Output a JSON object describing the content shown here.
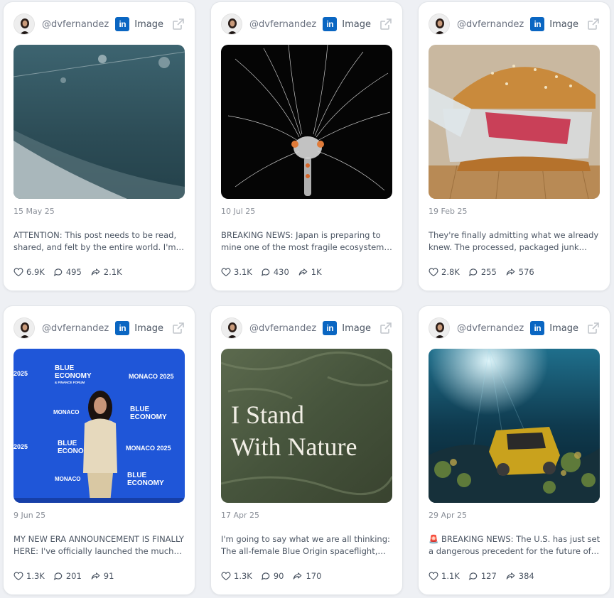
{
  "posts": [
    {
      "handle": "@dvfernandez",
      "network_icon": "linkedin-icon",
      "type_label": "Image",
      "date": "15 May 25",
      "caption": "ATTENTION: This post needs to be read, shared, and felt by the entire world. I'm…",
      "likes": "6.9K",
      "comments": "495",
      "shares": "2.1K",
      "image_subject": "misty underwater seafloor with buoy line"
    },
    {
      "handle": "@dvfernandez",
      "network_icon": "linkedin-icon",
      "type_label": "Image",
      "date": "10 Jul 25",
      "caption": "BREAKING NEWS: Japan is preparing to mine one of the most fragile ecosystem…",
      "likes": "3.1K",
      "comments": "430",
      "shares": "1K",
      "image_subject": "translucent deep-sea shrimp on black"
    },
    {
      "handle": "@dvfernandez",
      "network_icon": "linkedin-icon",
      "type_label": "Image",
      "date": "19 Feb 25",
      "caption": "They're finally admitting what we already knew. The processed, packaged junk…",
      "likes": "2.8K",
      "comments": "255",
      "shares": "576",
      "image_subject": "burger filled with plastic waste"
    },
    {
      "handle": "@dvfernandez",
      "network_icon": "linkedin-icon",
      "type_label": "Image",
      "date": "9 Jun 25",
      "caption": "MY NEW ERA ANNOUNCEMENT IS FINALLY HERE: I've officially launched the much…",
      "likes": "1.3K",
      "comments": "201",
      "shares": "91",
      "image_subject": "woman at event backdrop",
      "backdrop_texts": [
        "BLUE",
        "ECONOMY",
        "& FINANCE FORUM",
        "MONACO 2025",
        "MONACO",
        "2025"
      ]
    },
    {
      "handle": "@dvfernandez",
      "network_icon": "linkedin-icon",
      "type_label": "Image",
      "date": "17 Apr 25",
      "caption": "I'm going to say what we are all thinking: The all-female Blue Origin spaceflight,…",
      "likes": "1.3K",
      "comments": "90",
      "shares": "170",
      "image_subject": "painted texture with text",
      "image_text_line1": "I Stand",
      "image_text_line2": "With Nature"
    },
    {
      "handle": "@dvfernandez",
      "network_icon": "linkedin-icon",
      "type_label": "Image",
      "date": "29 Apr 25",
      "caption": "🚨 BREAKING NEWS: The U.S. has just set a dangerous precedent for the future of…",
      "likes": "1.1K",
      "comments": "127",
      "shares": "384",
      "image_subject": "underwater mining machine on reef"
    }
  ],
  "colors": {
    "linkedin": "#0a66c2",
    "page_background": "#eef0f4",
    "card": "#ffffff"
  }
}
